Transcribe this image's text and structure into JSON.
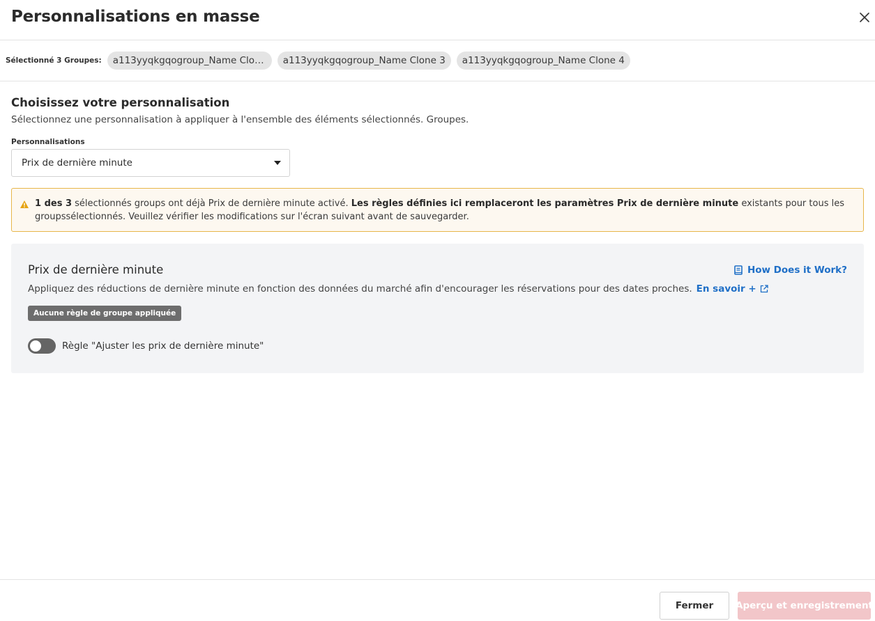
{
  "modal": {
    "title": "Personnalisations en masse"
  },
  "selection": {
    "label": "Sélectionné 3 Groupes:",
    "chips": [
      "a113yyqkgqogroup_Name Clone ...",
      "a113yyqkgqogroup_Name Clone 3",
      "a113yyqkgqogroup_Name Clone 4"
    ]
  },
  "customization": {
    "title": "Choisissez votre personnalisation",
    "description": "Sélectionnez une personnalisation à appliquer à l'ensemble des éléments sélectionnés. Groupes.",
    "field_label": "Personnalisations",
    "selected_value": "Prix de dernière minute"
  },
  "warning": {
    "count": "1 des 3",
    "text1": " sélectionnés groups ont déjà Prix de dernière minute activé. ",
    "bold": "Les règles définies ici remplaceront les paramètres Prix de dernière minute",
    "text2": " existants pour tous les groupssélectionnés. Veuillez vérifier les modifications sur l'écran suivant avant de sauvegarder."
  },
  "panel": {
    "title": "Prix de dernière minute",
    "how_link": "How Does it Work?",
    "description": "Appliquez des réductions de dernière minute en fonction des données du marché afin d'encourager les réservations pour des dates proches.",
    "learn_more": "En savoir +",
    "badge": "Aucune règle de groupe appliquée",
    "toggle_label": "Règle \"Ajuster les prix de dernière minute\"",
    "toggle_on": false
  },
  "footer": {
    "close_label": "Fermer",
    "save_label": "Aperçu et enregistrement"
  },
  "colors": {
    "link": "#1f6fc7",
    "warning_border": "#e7b64a",
    "warning_icon": "#e6a312",
    "save_disabled": "#f2c6c9"
  }
}
